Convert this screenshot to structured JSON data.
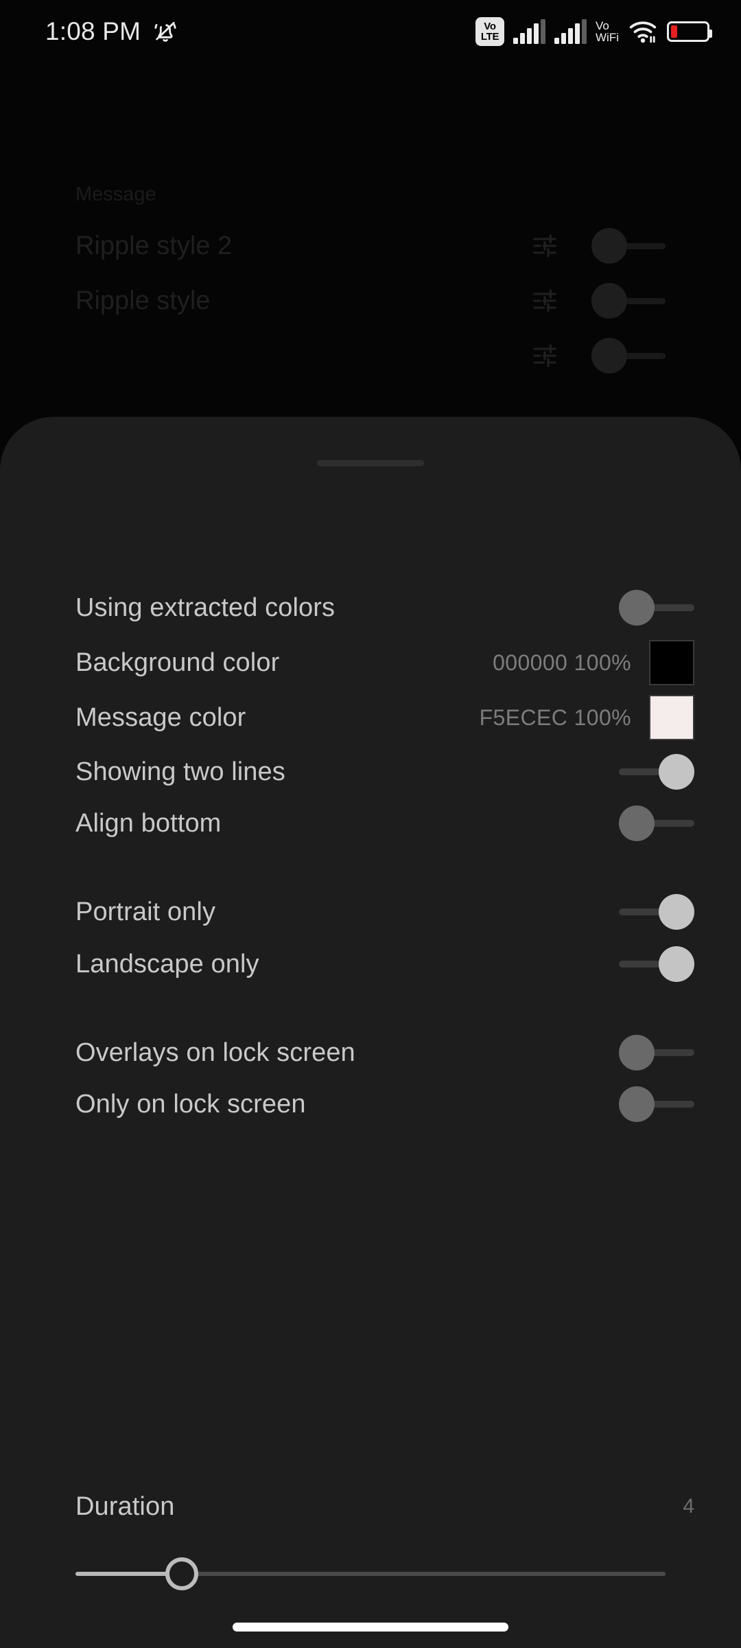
{
  "status_bar": {
    "time": "1:08 PM",
    "mute_icon": "bell-muted-icon",
    "volte_top": "Vo",
    "volte_bottom": "LTE",
    "vowifi_top": "Vo",
    "vowifi_bottom": "WiFi",
    "wifi_icon": "wifi-icon",
    "battery_icon": "battery-low-icon",
    "battery_level_percent": 18,
    "battery_color": "#e62020",
    "signal_icon": "cellular-signal-icon"
  },
  "background_list": {
    "rows": [
      {
        "label": "Message",
        "has_controls": false,
        "style": "small"
      },
      {
        "label": "Ripple style 2",
        "has_controls": true,
        "style": "normal"
      },
      {
        "label": "Ripple style",
        "has_controls": true,
        "style": "normal"
      },
      {
        "label": "",
        "has_controls": true,
        "style": "normal"
      }
    ],
    "tune_icon": "tune-sliders-icon"
  },
  "sheet": {
    "grabber": "drag-handle",
    "background_color": "#1d1d1d",
    "groups": [
      {
        "rows": [
          {
            "label": "Using extracted colors",
            "type": "switch",
            "value": "off"
          },
          {
            "label": "Background color",
            "type": "color",
            "hex": "000000",
            "opacity": "100%",
            "value_text": "000000 100%",
            "swatch_color": "#000000"
          },
          {
            "label": "Message color",
            "type": "color",
            "hex": "F5ECEC",
            "opacity": "100%",
            "value_text": "F5ECEC 100%",
            "swatch_color": "#f5ecec"
          },
          {
            "label": "Showing two lines",
            "type": "switch",
            "value": "on"
          },
          {
            "label": "Align bottom",
            "type": "switch",
            "value": "off"
          }
        ]
      },
      {
        "rows": [
          {
            "label": "Portrait only",
            "type": "switch",
            "value": "on"
          },
          {
            "label": "Landscape only",
            "type": "switch",
            "value": "on"
          }
        ]
      },
      {
        "rows": [
          {
            "label": "Overlays on lock screen",
            "type": "switch",
            "value": "off"
          },
          {
            "label": "Only on lock screen",
            "type": "switch",
            "value": "off"
          }
        ]
      }
    ],
    "duration": {
      "label": "Duration",
      "value": "4",
      "slider_percent": 18
    }
  },
  "navigation": {
    "gesture_bar": "home-gesture-bar"
  }
}
